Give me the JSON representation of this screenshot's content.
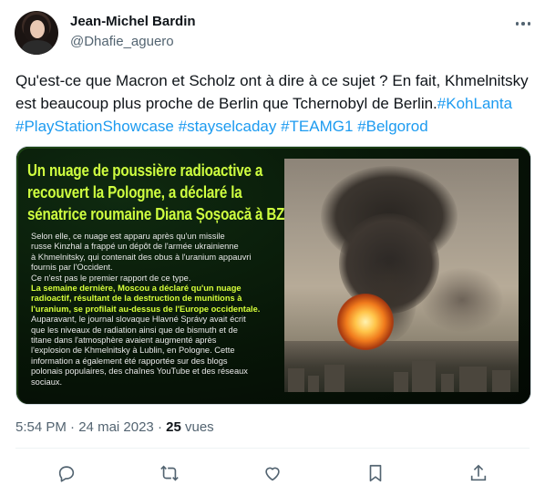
{
  "author": {
    "display_name": "Jean-Michel Bardin",
    "handle": "@Dhafie_aguero"
  },
  "tweet": {
    "text": "Qu'est-ce que Macron et Scholz ont à dire à ce sujet ? En fait, Khmelnitsky est beaucoup plus proche de Berlin que Tchernobyl de Berlin.",
    "hashtags": [
      "#KohLanta",
      "#PlayStationShowcase",
      "#stayselcaday",
      "#TEAMG1",
      "#Belgorod"
    ]
  },
  "media": {
    "headline": [
      "Un nuage de poussière radioactive a",
      "recouvert la Pologne, a déclaré la",
      "sénatrice roumaine Diana Șoșoacă à BZI."
    ],
    "body_lines": [
      "Selon elle, ce nuage est apparu après qu'un missile",
      "russe Kinzhal a frappé un dépôt de l'armée ukrainienne",
      "à Khmelnitsky, qui contenait des obus à l'uranium appauvri",
      "fournis par l'Occident.",
      "Ce n'est pas le premier rapport de ce type."
    ],
    "highlight_lines": [
      "La semaine dernière, Moscou a déclaré qu'un nuage",
      "radioactif, résultant de la destruction de munitions à",
      "l'uranium, se profilait au-dessus de l'Europe occidentale."
    ],
    "rest_lines": [
      "Auparavant, le journal slovaque Hlavné Správy avait écrit",
      "que les niveaux de radiation ainsi que de bismuth et de",
      "titane dans l'atmosphère avaient augmenté après",
      "l'explosion de Khmelnitsky à Lublin, en Pologne. Cette",
      "information a également été rapportée sur des blogs",
      "polonais populaires, des chaînes YouTube et des réseaux",
      "sociaux."
    ]
  },
  "meta": {
    "time": "5:54 PM",
    "separator": "·",
    "date": "24 mai 2023",
    "views_count": "25",
    "views_label": "vues"
  },
  "icons": [
    "more-icon",
    "reply-icon",
    "retweet-icon",
    "like-icon",
    "bookmark-icon",
    "share-icon"
  ],
  "colors": {
    "link": "#1d9bf0",
    "secondary": "#536471",
    "headline": "#cfff40"
  }
}
